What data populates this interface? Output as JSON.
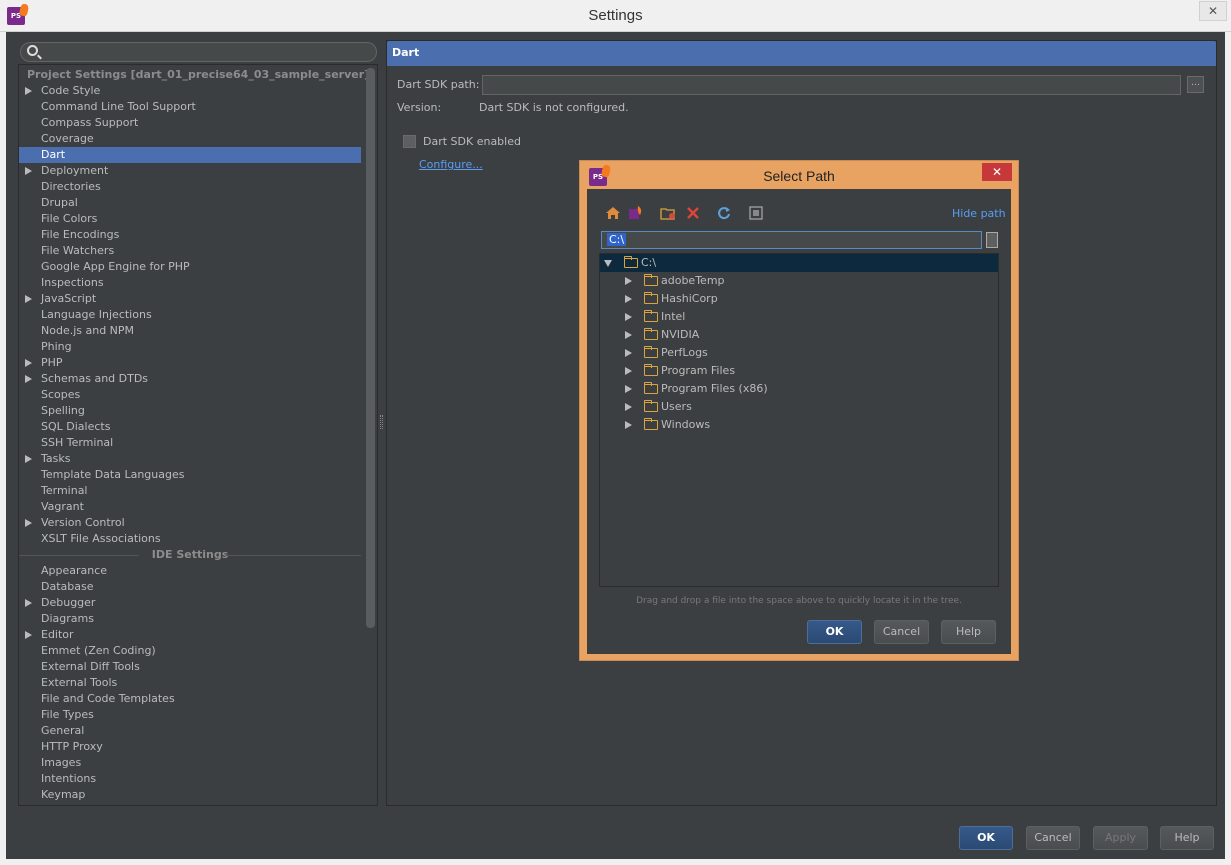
{
  "window": {
    "title": "Settings",
    "close_glyph": "✕",
    "logo_text": "PS"
  },
  "search": {
    "placeholder": ""
  },
  "tree": {
    "project_header": "Project Settings [dart_01_precise64_03_sample_server]",
    "project_items": [
      {
        "label": "Code Style",
        "expandable": true
      },
      {
        "label": "Command Line Tool Support",
        "expandable": false
      },
      {
        "label": "Compass Support",
        "expandable": false
      },
      {
        "label": "Coverage",
        "expandable": false
      },
      {
        "label": "Dart",
        "expandable": false,
        "selected": true
      },
      {
        "label": "Deployment",
        "expandable": true
      },
      {
        "label": "Directories",
        "expandable": false
      },
      {
        "label": "Drupal",
        "expandable": false
      },
      {
        "label": "File Colors",
        "expandable": false
      },
      {
        "label": "File Encodings",
        "expandable": false
      },
      {
        "label": "File Watchers",
        "expandable": false
      },
      {
        "label": "Google App Engine for PHP",
        "expandable": false
      },
      {
        "label": "Inspections",
        "expandable": false
      },
      {
        "label": "JavaScript",
        "expandable": true
      },
      {
        "label": "Language Injections",
        "expandable": false
      },
      {
        "label": "Node.js and NPM",
        "expandable": false
      },
      {
        "label": "Phing",
        "expandable": false
      },
      {
        "label": "PHP",
        "expandable": true
      },
      {
        "label": "Schemas and DTDs",
        "expandable": true
      },
      {
        "label": "Scopes",
        "expandable": false
      },
      {
        "label": "Spelling",
        "expandable": false
      },
      {
        "label": "SQL Dialects",
        "expandable": false
      },
      {
        "label": "SSH Terminal",
        "expandable": false
      },
      {
        "label": "Tasks",
        "expandable": true
      },
      {
        "label": "Template Data Languages",
        "expandable": false
      },
      {
        "label": "Terminal",
        "expandable": false
      },
      {
        "label": "Vagrant",
        "expandable": false
      },
      {
        "label": "Version Control",
        "expandable": true
      },
      {
        "label": "XSLT File Associations",
        "expandable": false
      }
    ],
    "ide_header": "IDE Settings",
    "ide_items": [
      {
        "label": "Appearance",
        "expandable": false
      },
      {
        "label": "Database",
        "expandable": false
      },
      {
        "label": "Debugger",
        "expandable": true
      },
      {
        "label": "Diagrams",
        "expandable": false
      },
      {
        "label": "Editor",
        "expandable": true
      },
      {
        "label": "Emmet (Zen Coding)",
        "expandable": false
      },
      {
        "label": "External Diff Tools",
        "expandable": false
      },
      {
        "label": "External Tools",
        "expandable": false
      },
      {
        "label": "File and Code Templates",
        "expandable": false
      },
      {
        "label": "File Types",
        "expandable": false
      },
      {
        "label": "General",
        "expandable": false
      },
      {
        "label": "HTTP Proxy",
        "expandable": false
      },
      {
        "label": "Images",
        "expandable": false
      },
      {
        "label": "Intentions",
        "expandable": false
      },
      {
        "label": "Keymap",
        "expandable": false
      }
    ]
  },
  "dart": {
    "header": "Dart",
    "sdk_path_label": "Dart SDK path:",
    "sdk_path_value": "",
    "browse_glyph": "…",
    "version_label": "Version:",
    "version_value": "Dart SDK is not configured.",
    "sdk_enabled_label": "Dart SDK enabled",
    "sdk_enabled": false,
    "configure_link": "Configure..."
  },
  "buttons": {
    "ok": "OK",
    "cancel": "Cancel",
    "apply": "Apply",
    "help": "Help"
  },
  "dialog": {
    "title": "Select Path",
    "close_glyph": "✕",
    "hide_path": "Hide path",
    "path_value": "C:\\",
    "toolbar_icons": [
      "home-icon",
      "project-icon",
      "new-folder-icon",
      "delete-icon",
      "refresh-icon",
      "show-hidden-icon"
    ],
    "root": "C:\\",
    "folders": [
      "adobeTemp",
      "HashiCorp",
      "Intel",
      "NVIDIA",
      "PerfLogs",
      "Program Files",
      "Program Files (x86)",
      "Users",
      "Windows"
    ],
    "drag_hint": "Drag and drop a file into the space above to quickly locate it in the tree.",
    "ok": "OK",
    "cancel": "Cancel",
    "help": "Help"
  },
  "colors": {
    "selection": "#4b6eaf",
    "link": "#589df6",
    "dialog_border": "#e8a262",
    "close_red": "#c7383a",
    "tree_selection": "#0d293e"
  }
}
